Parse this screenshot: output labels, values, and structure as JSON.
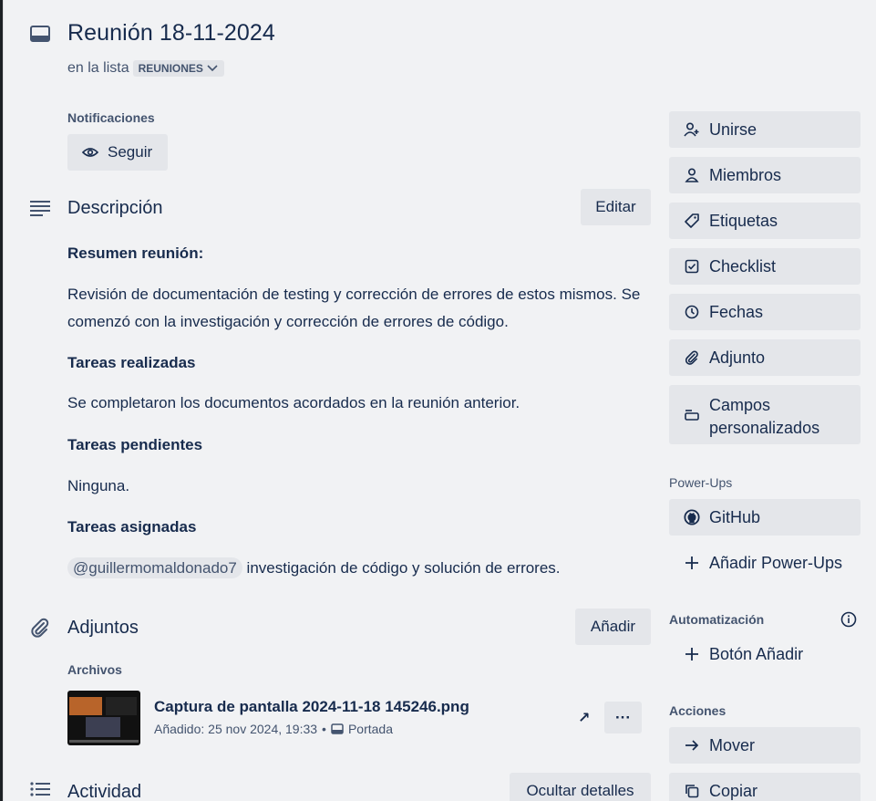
{
  "card": {
    "title": "Reunión 18-11-2024",
    "in_list_prefix": "en la lista",
    "list_name": "REUNIONES"
  },
  "notifications": {
    "label": "Notificaciones",
    "follow_button": "Seguir"
  },
  "description": {
    "title": "Descripción",
    "edit_button": "Editar",
    "h1": "Resumen reunión:",
    "p1": "Revisión de documentación de testing y corrección de errores de estos mismos. Se comenzó con la investigación y corrección de errores de código.",
    "h2": "Tareas realizadas",
    "p2": "Se completaron los documentos acordados en la reunión anterior.",
    "h3": "Tareas pendientes",
    "p3": "Ninguna.",
    "h4": "Tareas asignadas",
    "mention": "@guillermomaldonado7",
    "p4": "investigación de código y solución de errores."
  },
  "attachments": {
    "title": "Adjuntos",
    "add_button": "Añadir",
    "files_label": "Archivos",
    "file_name": "Captura de pantalla 2024-11-18 145246.png",
    "file_added": "Añadido: 25 nov 2024, 19:33",
    "file_bullet": "•",
    "file_cover": "Portada",
    "more_label": "···",
    "open_label": "↗"
  },
  "activity": {
    "title": "Actividad",
    "hide_details_button": "Ocultar detalles"
  },
  "sidebar": {
    "join": "Unirse",
    "members": "Miembros",
    "labels": "Etiquetas",
    "checklist": "Checklist",
    "dates": "Fechas",
    "attachment": "Adjunto",
    "custom_fields_1": "Campos",
    "custom_fields_2": "personalizados",
    "powerups_label": "Power-Ups",
    "github": "GitHub",
    "add_powerups": "Añadir Power-Ups",
    "automation_label": "Automatización",
    "add_button": "Botón Añadir",
    "actions_label": "Acciones",
    "move": "Mover",
    "copy": "Copiar"
  }
}
